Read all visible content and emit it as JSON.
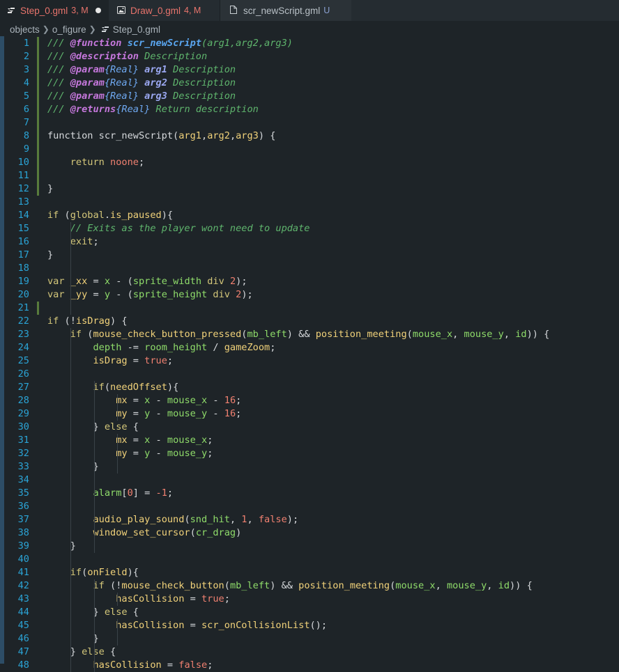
{
  "tabs": [
    {
      "label": "Step_0.gml",
      "status": "3, M",
      "icon": "gml-script-icon",
      "active": true
    },
    {
      "label": "Draw_0.gml",
      "status": "4, M",
      "icon": "image-file-icon"
    },
    {
      "label": "scr_newScript.gml",
      "status": "U",
      "icon": "file-icon"
    }
  ],
  "breadcrumb": [
    "objects",
    "o_figure",
    "Step_0.gml"
  ],
  "code_lines": [
    [
      [
        "cmt",
        "/// "
      ],
      [
        "tag",
        "@function"
      ],
      [
        "cmt",
        " "
      ],
      [
        "fname",
        "scr_newScript"
      ],
      [
        "cmt",
        "(arg1,arg2,arg3)"
      ]
    ],
    [
      [
        "cmt",
        "/// "
      ],
      [
        "tag",
        "@description"
      ],
      [
        "cmt",
        " Description"
      ]
    ],
    [
      [
        "cmt",
        "/// "
      ],
      [
        "tag",
        "@param"
      ],
      [
        "typ",
        "{Real}"
      ],
      [
        "cmt",
        " "
      ],
      [
        "arg",
        "arg1"
      ],
      [
        "cmt",
        " Description"
      ]
    ],
    [
      [
        "cmt",
        "/// "
      ],
      [
        "tag",
        "@param"
      ],
      [
        "typ",
        "{Real}"
      ],
      [
        "cmt",
        " "
      ],
      [
        "arg",
        "arg2"
      ],
      [
        "cmt",
        " Description"
      ]
    ],
    [
      [
        "cmt",
        "/// "
      ],
      [
        "tag",
        "@param"
      ],
      [
        "typ",
        "{Real}"
      ],
      [
        "cmt",
        " "
      ],
      [
        "arg",
        "arg3"
      ],
      [
        "cmt",
        " Description"
      ]
    ],
    [
      [
        "cmt",
        "/// "
      ],
      [
        "tag",
        "@returns"
      ],
      [
        "typ",
        "{Real}"
      ],
      [
        "cmt",
        " Return description"
      ]
    ],
    [],
    [
      [
        "p",
        "function scr_newScript("
      ],
      [
        "fn",
        "arg1"
      ],
      [
        "p",
        ","
      ],
      [
        "fn",
        "arg2"
      ],
      [
        "p",
        ","
      ],
      [
        "fn",
        "arg3"
      ],
      [
        "p",
        ") {"
      ]
    ],
    [],
    [
      [
        "p",
        "    "
      ],
      [
        "kw",
        "return"
      ],
      [
        "p",
        " "
      ],
      [
        "lit",
        "noone"
      ],
      [
        "p",
        ";"
      ]
    ],
    [],
    [
      [
        "p",
        "}"
      ]
    ],
    [],
    [
      [
        "kw",
        "if"
      ],
      [
        "p",
        " ("
      ],
      [
        "kw",
        "global"
      ],
      [
        "p",
        "."
      ],
      [
        "fn",
        "is_paused"
      ],
      [
        "p",
        "){"
      ]
    ],
    [
      [
        "p",
        "    "
      ],
      [
        "cmt",
        "// Exits as the player wont need to update"
      ]
    ],
    [
      [
        "p",
        "    "
      ],
      [
        "kw",
        "exit"
      ],
      [
        "p",
        ";"
      ]
    ],
    [
      [
        "p",
        "}"
      ]
    ],
    [],
    [
      [
        "kw",
        "var"
      ],
      [
        "p",
        " "
      ],
      [
        "fn",
        "_xx"
      ],
      [
        "p",
        " = "
      ],
      [
        "var",
        "x"
      ],
      [
        "p",
        " - ("
      ],
      [
        "var",
        "sprite_width"
      ],
      [
        "p",
        " "
      ],
      [
        "kw",
        "div"
      ],
      [
        "p",
        " "
      ],
      [
        "num",
        "2"
      ],
      [
        "p",
        ");"
      ]
    ],
    [
      [
        "kw",
        "var"
      ],
      [
        "p",
        " "
      ],
      [
        "fn",
        "_yy"
      ],
      [
        "p",
        " = "
      ],
      [
        "var",
        "y"
      ],
      [
        "p",
        " - ("
      ],
      [
        "var",
        "sprite_height"
      ],
      [
        "p",
        " "
      ],
      [
        "kw",
        "div"
      ],
      [
        "p",
        " "
      ],
      [
        "num",
        "2"
      ],
      [
        "p",
        ");"
      ]
    ],
    [],
    [
      [
        "kw",
        "if"
      ],
      [
        "p",
        " (!"
      ],
      [
        "fn",
        "isDrag"
      ],
      [
        "p",
        ") {"
      ]
    ],
    [
      [
        "p",
        "    "
      ],
      [
        "kw",
        "if"
      ],
      [
        "p",
        " ("
      ],
      [
        "fn",
        "mouse_check_button_pressed"
      ],
      [
        "p",
        "("
      ],
      [
        "var",
        "mb_left"
      ],
      [
        "p",
        ") && "
      ],
      [
        "fn",
        "position_meeting"
      ],
      [
        "p",
        "("
      ],
      [
        "var",
        "mouse_x"
      ],
      [
        "p",
        ", "
      ],
      [
        "var",
        "mouse_y"
      ],
      [
        "p",
        ", "
      ],
      [
        "var",
        "id"
      ],
      [
        "p",
        ")) {"
      ]
    ],
    [
      [
        "p",
        "        "
      ],
      [
        "var",
        "depth"
      ],
      [
        "p",
        " -= "
      ],
      [
        "var",
        "room_height"
      ],
      [
        "p",
        " / "
      ],
      [
        "fn",
        "gameZoom"
      ],
      [
        "p",
        ";"
      ]
    ],
    [
      [
        "p",
        "        "
      ],
      [
        "fn",
        "isDrag"
      ],
      [
        "p",
        " = "
      ],
      [
        "lit",
        "true"
      ],
      [
        "p",
        ";"
      ]
    ],
    [],
    [
      [
        "p",
        "        "
      ],
      [
        "kw",
        "if"
      ],
      [
        "p",
        "("
      ],
      [
        "fn",
        "needOffset"
      ],
      [
        "p",
        "){"
      ]
    ],
    [
      [
        "p",
        "            "
      ],
      [
        "fn",
        "mx"
      ],
      [
        "p",
        " = "
      ],
      [
        "var",
        "x"
      ],
      [
        "p",
        " - "
      ],
      [
        "var",
        "mouse_x"
      ],
      [
        "p",
        " - "
      ],
      [
        "num",
        "16"
      ],
      [
        "p",
        ";"
      ]
    ],
    [
      [
        "p",
        "            "
      ],
      [
        "fn",
        "my"
      ],
      [
        "p",
        " = "
      ],
      [
        "var",
        "y"
      ],
      [
        "p",
        " - "
      ],
      [
        "var",
        "mouse_y"
      ],
      [
        "p",
        " - "
      ],
      [
        "num",
        "16"
      ],
      [
        "p",
        ";"
      ]
    ],
    [
      [
        "p",
        "        } "
      ],
      [
        "kw",
        "else"
      ],
      [
        "p",
        " {"
      ]
    ],
    [
      [
        "p",
        "            "
      ],
      [
        "fn",
        "mx"
      ],
      [
        "p",
        " = "
      ],
      [
        "var",
        "x"
      ],
      [
        "p",
        " - "
      ],
      [
        "var",
        "mouse_x"
      ],
      [
        "p",
        ";"
      ]
    ],
    [
      [
        "p",
        "            "
      ],
      [
        "fn",
        "my"
      ],
      [
        "p",
        " = "
      ],
      [
        "var",
        "y"
      ],
      [
        "p",
        " - "
      ],
      [
        "var",
        "mouse_y"
      ],
      [
        "p",
        ";"
      ]
    ],
    [
      [
        "p",
        "        }"
      ]
    ],
    [],
    [
      [
        "p",
        "        "
      ],
      [
        "var",
        "alarm"
      ],
      [
        "p",
        "["
      ],
      [
        "num",
        "0"
      ],
      [
        "p",
        "] = "
      ],
      [
        "num",
        "-1"
      ],
      [
        "p",
        ";"
      ]
    ],
    [],
    [
      [
        "p",
        "        "
      ],
      [
        "fn",
        "audio_play_sound"
      ],
      [
        "p",
        "("
      ],
      [
        "var",
        "snd_hit"
      ],
      [
        "p",
        ", "
      ],
      [
        "num",
        "1"
      ],
      [
        "p",
        ", "
      ],
      [
        "lit",
        "false"
      ],
      [
        "p",
        ");"
      ]
    ],
    [
      [
        "p",
        "        "
      ],
      [
        "fn",
        "window_set_cursor"
      ],
      [
        "p",
        "("
      ],
      [
        "var",
        "cr_drag"
      ],
      [
        "p",
        ")"
      ]
    ],
    [
      [
        "p",
        "    }"
      ]
    ],
    [],
    [
      [
        "p",
        "    "
      ],
      [
        "kw",
        "if"
      ],
      [
        "p",
        "("
      ],
      [
        "fn",
        "onField"
      ],
      [
        "p",
        "){"
      ]
    ],
    [
      [
        "p",
        "        "
      ],
      [
        "kw",
        "if"
      ],
      [
        "p",
        " (!"
      ],
      [
        "fn",
        "mouse_check_button"
      ],
      [
        "p",
        "("
      ],
      [
        "var",
        "mb_left"
      ],
      [
        "p",
        ") && "
      ],
      [
        "fn",
        "position_meeting"
      ],
      [
        "p",
        "("
      ],
      [
        "var",
        "mouse_x"
      ],
      [
        "p",
        ", "
      ],
      [
        "var",
        "mouse_y"
      ],
      [
        "p",
        ", "
      ],
      [
        "var",
        "id"
      ],
      [
        "p",
        ")) {"
      ]
    ],
    [
      [
        "p",
        "            "
      ],
      [
        "fn",
        "hasCollision"
      ],
      [
        "p",
        " = "
      ],
      [
        "lit",
        "true"
      ],
      [
        "p",
        ";"
      ]
    ],
    [
      [
        "p",
        "        } "
      ],
      [
        "kw",
        "else"
      ],
      [
        "p",
        " {"
      ]
    ],
    [
      [
        "p",
        "            "
      ],
      [
        "fn",
        "hasCollision"
      ],
      [
        "p",
        " = "
      ],
      [
        "fn",
        "scr_onCollisionList"
      ],
      [
        "p",
        "();"
      ]
    ],
    [
      [
        "p",
        "        }"
      ]
    ],
    [
      [
        "p",
        "    } "
      ],
      [
        "kw",
        "else"
      ],
      [
        "p",
        " {"
      ]
    ],
    [
      [
        "p",
        "        "
      ],
      [
        "fn",
        "hasCollision"
      ],
      [
        "p",
        " = "
      ],
      [
        "lit",
        "false"
      ],
      [
        "p",
        ";"
      ]
    ]
  ],
  "colors": {
    "background": "#1e2428",
    "line_number": "#2ba4d6",
    "comment": "#5fb56d",
    "keyword": "#d4c77a",
    "identifier": "#f1d27a",
    "builtin": "#8fdc6a",
    "number": "#f08070"
  }
}
